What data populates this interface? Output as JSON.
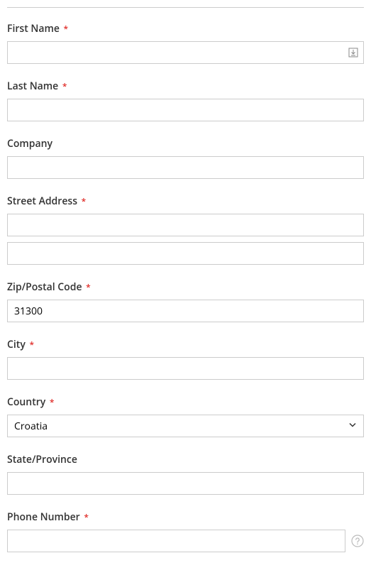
{
  "form": {
    "first_name": {
      "label": "First Name",
      "value": "",
      "required": true
    },
    "last_name": {
      "label": "Last Name",
      "value": "",
      "required": true
    },
    "company": {
      "label": "Company",
      "value": "",
      "required": false
    },
    "street_address": {
      "label": "Street Address",
      "value1": "",
      "value2": "",
      "required": true
    },
    "zip": {
      "label": "Zip/Postal Code",
      "value": "31300",
      "required": true
    },
    "city": {
      "label": "City",
      "value": "",
      "required": true
    },
    "country": {
      "label": "Country",
      "selected": "Croatia",
      "required": true
    },
    "state": {
      "label": "State/Province",
      "value": "",
      "required": false
    },
    "phone": {
      "label": "Phone Number",
      "value": "",
      "required": true
    }
  },
  "required_mark": "*"
}
